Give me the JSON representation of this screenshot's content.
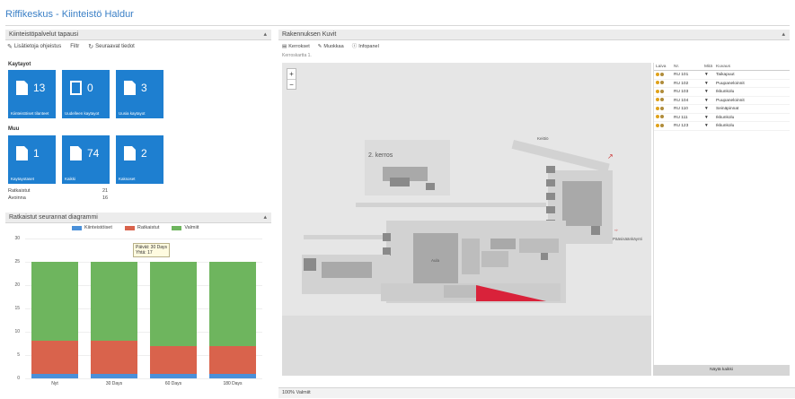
{
  "page_title": "Riffikeskus - Kiinteistö Haldur",
  "left_panel": {
    "header": "Kiinteistöpalvelut tapausi",
    "collapse_icon": "chevron-up-icon",
    "toolbar": [
      {
        "icon": "wrench-icon",
        "label": "Lisätietoja ohjeistus"
      },
      {
        "icon": "filter-icon",
        "label": "Filtr"
      },
      {
        "icon": "refresh-icon",
        "label": "Seuraavat tiedot"
      }
    ],
    "group1_label": "Kaytayot",
    "group1_tiles": [
      {
        "count": "13",
        "label": "Kiinteistöiset tilanteet",
        "icon": "document-icon"
      },
      {
        "count": "0",
        "label": "Uudelleen kaytayot",
        "icon": "document-outline-icon"
      },
      {
        "count": "3",
        "label": "Uusia kaytayot",
        "icon": "document-icon"
      }
    ],
    "group2_label": "Muu",
    "group2_tiles": [
      {
        "count": "1",
        "label": "Kaytayotaset",
        "icon": "document-icon"
      },
      {
        "count": "74",
        "label": "Kaikki",
        "icon": "document-icon"
      },
      {
        "count": "2",
        "label": "Kaksoset",
        "icon": "document-icon"
      }
    ],
    "stats": [
      {
        "label": "Ratkaistut",
        "value": "21"
      },
      {
        "label": "Avoinna",
        "value": "16"
      }
    ]
  },
  "chart_panel": {
    "header": "Ratkaistut seurannat diagrammi",
    "collapse_icon": "chevron-up-icon",
    "tooltip_lines": [
      "Päivät: 30 Days",
      "Yhtä: 17"
    ]
  },
  "chart_data": {
    "type": "bar",
    "stacked": true,
    "categories": [
      "Nyt",
      "30 Days",
      "60 Days",
      "180 Days"
    ],
    "series": [
      {
        "name": "Kiinteistöiset",
        "color": "#4a90d9",
        "values": [
          1,
          1,
          1,
          1
        ]
      },
      {
        "name": "Ratkaistut",
        "color": "#d9634c",
        "values": [
          7,
          7,
          6,
          6
        ]
      },
      {
        "name": "Valmiit",
        "color": "#6eb55e",
        "values": [
          17,
          17,
          18,
          18
        ]
      }
    ],
    "ylim": [
      0,
      30
    ],
    "yticks": [
      0,
      5,
      10,
      15,
      20,
      25,
      30
    ],
    "legend_position": "top"
  },
  "map_panel": {
    "header": "Rakennuksen Kuvit",
    "collapse_icon": "chevron-up-icon",
    "toolbar": [
      {
        "icon": "floor-icon",
        "label": "Kerrokset"
      },
      {
        "icon": "edit-icon",
        "label": "Muokkaa"
      },
      {
        "icon": "info-icon",
        "label": "Infopanel"
      }
    ],
    "subtitle": "Kerroskartta 1.",
    "zoom_in": "+",
    "zoom_out": "−",
    "map_labels": {
      "floor": "2. kerros",
      "room1": "Aula",
      "room2": "Keittiö",
      "entrance": "Pääsisäänkäynti"
    },
    "footer": "100% Valmiit"
  },
  "room_list": {
    "headers": [
      "Laiva",
      "Nr.",
      "Mitä",
      "Kuvaus"
    ],
    "rows": [
      {
        "nr": "RU 101",
        "mark": "▼",
        "desc": "Taikapuut"
      },
      {
        "nr": "RU 102",
        "mark": "▼",
        "desc": "Puupaneloinnit"
      },
      {
        "nr": "RU 103",
        "mark": "▼",
        "desc": "Ikkunkolu"
      },
      {
        "nr": "RU 104",
        "mark": "▼",
        "desc": "Puupaneloinnit"
      },
      {
        "nr": "RU 110",
        "mark": "▼",
        "desc": "Seinäpinnat"
      },
      {
        "nr": "RU 111",
        "mark": "▼",
        "desc": "Ikkunkolu"
      },
      {
        "nr": "RU 123",
        "mark": "▼",
        "desc": "Ikkunkolu"
      }
    ],
    "row_icons": [
      "warning-icon",
      "gear-icon"
    ],
    "footer_button": "Näytä kaikki"
  }
}
